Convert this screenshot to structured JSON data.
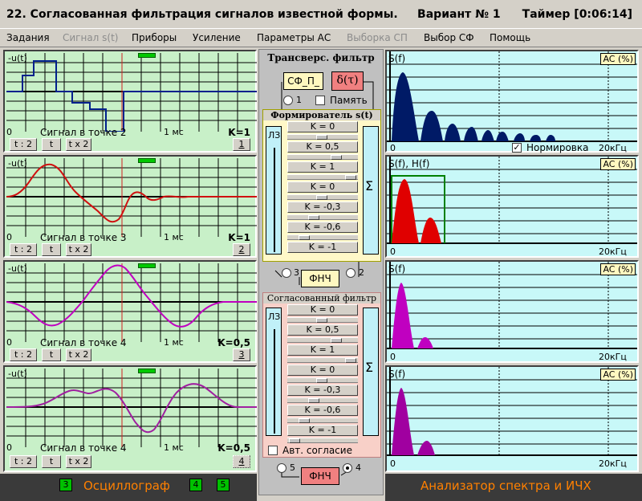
{
  "window": {
    "title": "22. Согласованная фильтрация сигналов известной формы.     Вариант № 1",
    "timer": "Таймер [0:06:14]"
  },
  "menu": [
    {
      "label": "Задания",
      "enabled": true
    },
    {
      "label": "Сигнал s(t)",
      "enabled": false
    },
    {
      "label": "Приборы",
      "enabled": true
    },
    {
      "label": "Усиление",
      "enabled": true
    },
    {
      "label": "Параметры  АС",
      "enabled": true
    },
    {
      "label": "Выборка СП",
      "enabled": false
    },
    {
      "label": "Выбор СФ",
      "enabled": true
    },
    {
      "label": "Помощь",
      "enabled": true
    }
  ],
  "oscilloscopes": [
    {
      "axis": "-u(t)",
      "t0": "0",
      "title": "Сигнал в точке 2",
      "time": "1 мс",
      "k": "K=1",
      "btns": [
        "t : 2",
        "t",
        "t x 2"
      ],
      "num": "1",
      "color": "#00208c"
    },
    {
      "axis": "-u(t)",
      "t0": "0",
      "title": "Сигнал в точке 3",
      "time": "1 мс",
      "k": "K=1",
      "btns": [
        "t : 2",
        "t",
        "t x 2"
      ],
      "num": "2",
      "color": "#d01010"
    },
    {
      "axis": "-u(t)",
      "t0": "0",
      "title": "Сигнал в точке 4",
      "time": "1 мс",
      "k": "K=0,5",
      "btns": [
        "t : 2",
        "t",
        "t x 2"
      ],
      "num": "3",
      "color": "#c000c0"
    },
    {
      "axis": "-u(t)",
      "t0": "0",
      "title": "Сигнал в точке 4",
      "time": "1 мс",
      "k": "K=0,5",
      "btns": [
        "t : 2",
        "t",
        "t x 2"
      ],
      "num": "4",
      "color": "#a020a0"
    }
  ],
  "center": {
    "heading": "Трансверс. фильтр",
    "sf": "СФ_П_",
    "delta": "δ(τ)",
    "radio1": "1",
    "memory": "Память",
    "former_title": "Формирователь s(t)",
    "lz": "ЛЗ",
    "sum": "Σ",
    "former_k": [
      "K = 0",
      "K = 0,5",
      "K = 1",
      "K = 0",
      "K = -0,3",
      "K = -0,6",
      "K = -1"
    ],
    "radio3": "3",
    "radio2": "2",
    "fnch": "ФНЧ",
    "matched_title": "Согласованный фильтр",
    "matched_k": [
      "K = 0",
      "K = 0,5",
      "K = 1",
      "K = 0",
      "K = -0,3",
      "K = -0,6",
      "K = -1"
    ],
    "auto": "Авт. согласие",
    "radio5": "5",
    "radio4": "4",
    "fnch2": "ФНЧ"
  },
  "spectra": [
    {
      "label": "S(f)",
      "ac": "AC (%)",
      "f0": "0",
      "fmax": "20кГц",
      "color": "#001a66",
      "norm": "Нормировка"
    },
    {
      "label": "S(f), H(f)",
      "ac": "AC (%)",
      "f0": "0",
      "fmax": "20кГц",
      "color": "#e00000"
    },
    {
      "label": "S(f)",
      "ac": "AC (%)",
      "f0": "0",
      "fmax": "20кГц",
      "color": "#c000c0"
    },
    {
      "label": "S(f)",
      "ac": "AC (%)",
      "f0": "0",
      "fmax": "20кГц",
      "color": "#a000a0"
    }
  ],
  "bottom": {
    "osc_nums": [
      "3",
      "4",
      "5"
    ],
    "osc_label": "Осциллограф",
    "analyzer_label": "Анализатор спектра и ИЧХ"
  }
}
